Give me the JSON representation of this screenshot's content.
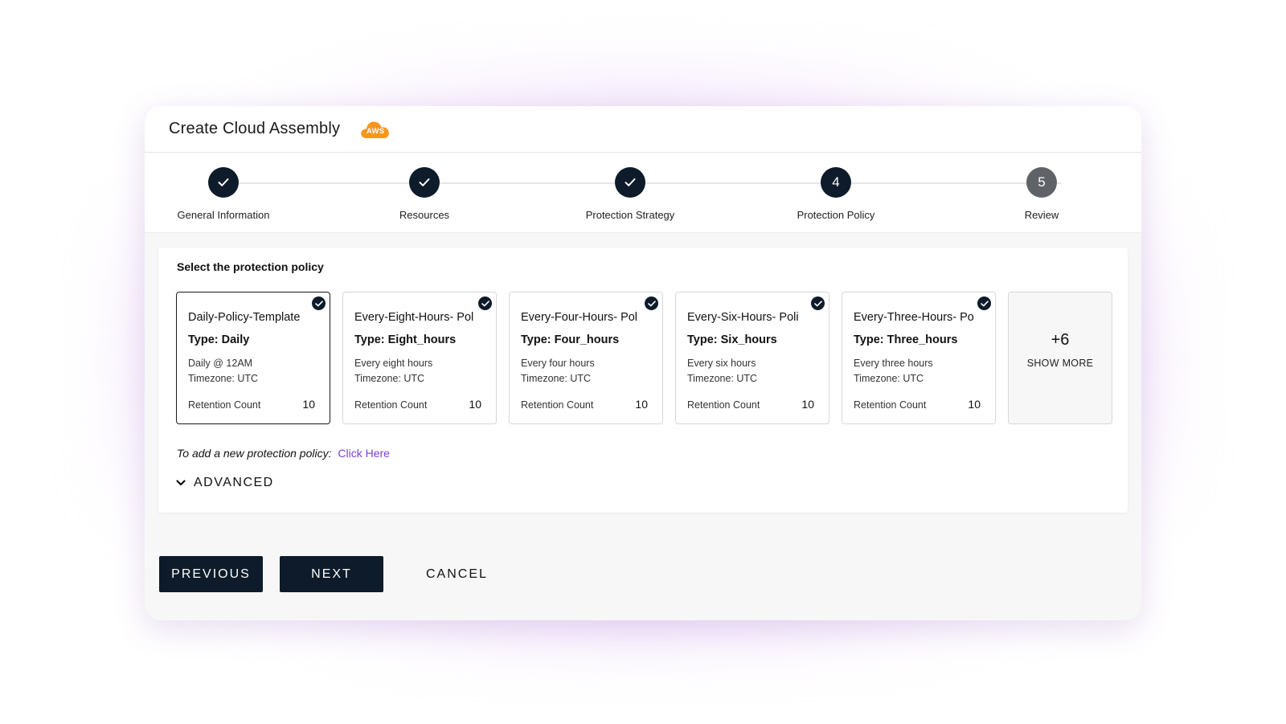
{
  "header": {
    "title": "Create Cloud Assembly",
    "badge_text": "AWS",
    "badge_color": "#f7961d"
  },
  "stepper": {
    "steps": [
      {
        "label": "General Information",
        "state": "complete",
        "number": "1"
      },
      {
        "label": "Resources",
        "state": "complete",
        "number": "2"
      },
      {
        "label": "Protection Strategy",
        "state": "complete",
        "number": "3"
      },
      {
        "label": "Protection Policy",
        "state": "active",
        "number": "4"
      },
      {
        "label": "Review",
        "state": "pending",
        "number": "5"
      }
    ]
  },
  "policy": {
    "heading": "Select the protection policy",
    "cards": [
      {
        "name": "Daily-Policy-Template",
        "type": "Type: Daily",
        "desc1": "Daily @ 12AM",
        "desc2": "Timezone: UTC",
        "retention_label": "Retention Count",
        "retention_value": "10",
        "selected": true
      },
      {
        "name": "Every-Eight-Hours- Pol",
        "type": "Type: Eight_hours",
        "desc1": "Every eight hours",
        "desc2": "Timezone: UTC",
        "retention_label": "Retention Count",
        "retention_value": "10",
        "selected": false
      },
      {
        "name": "Every-Four-Hours- Pol",
        "type": "Type: Four_hours",
        "desc1": "Every four hours",
        "desc2": "Timezone: UTC",
        "retention_label": "Retention Count",
        "retention_value": "10",
        "selected": false
      },
      {
        "name": "Every-Six-Hours- Poli",
        "type": "Type: Six_hours",
        "desc1": "Every six hours",
        "desc2": "Timezone: UTC",
        "retention_label": "Retention Count",
        "retention_value": "10",
        "selected": false
      },
      {
        "name": "Every-Three-Hours- Po",
        "type": "Type: Three_hours",
        "desc1": "Every three hours",
        "desc2": "Timezone: UTC",
        "retention_label": "Retention Count",
        "retention_value": "10",
        "selected": false
      }
    ],
    "more": {
      "count": "+6",
      "label": "SHOW MORE"
    },
    "add_prefix": "To add a new protection policy:",
    "add_link": "Click Here",
    "advanced_label": "ADVANCED"
  },
  "footer": {
    "previous_label": "PREVIOUS",
    "next_label": "NEXT",
    "cancel_label": "CANCEL"
  },
  "colors": {
    "primary_dark": "#0d1b2a",
    "pending_step": "#5f6368",
    "link": "#7b3fd6",
    "glow": "#c27ee8"
  }
}
